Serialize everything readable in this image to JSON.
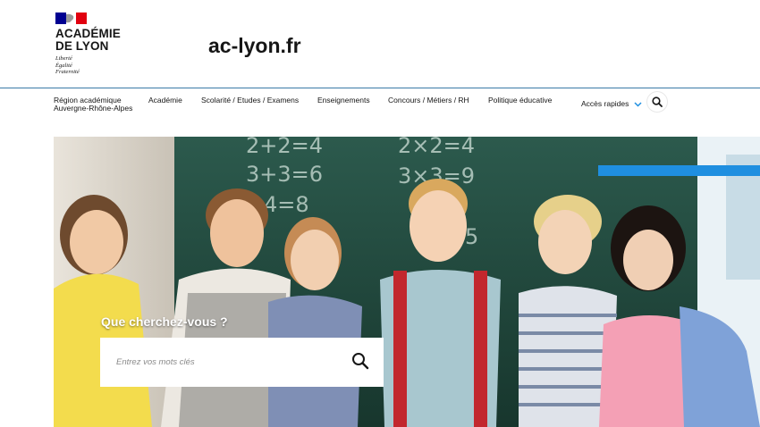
{
  "header": {
    "logo": {
      "line1": "ACADÉMIE",
      "line2": "DE LYON",
      "devise": [
        "Liberté",
        "Égalité",
        "Fraternité"
      ]
    },
    "site_name": "ac-lyon.fr"
  },
  "nav": {
    "items": [
      {
        "label_line1": "Région académique",
        "label_line2": "Auvergne-Rhône-Alpes"
      },
      {
        "label": "Académie"
      },
      {
        "label": "Scolarité / Etudes / Examens"
      },
      {
        "label": "Enseignements"
      },
      {
        "label": "Concours / Métiers / RH"
      },
      {
        "label": "Politique éducative"
      }
    ],
    "quick_access": "Accès rapides"
  },
  "hero": {
    "search_title": "Que cherchez-vous ?",
    "search_placeholder": "Entrez vos mots clés",
    "chalkboard": [
      "2+2=4",
      "3+3=6",
      "4=8",
      "2×2=4",
      "3×3=9",
      "5"
    ]
  },
  "colors": {
    "accent": "#1f8fe0",
    "rule": "#3b7aa8",
    "text": "#161616",
    "chalkboard": "#20473d"
  },
  "icons": [
    "marianne-flag-icon",
    "chevron-down-icon",
    "search-icon"
  ]
}
